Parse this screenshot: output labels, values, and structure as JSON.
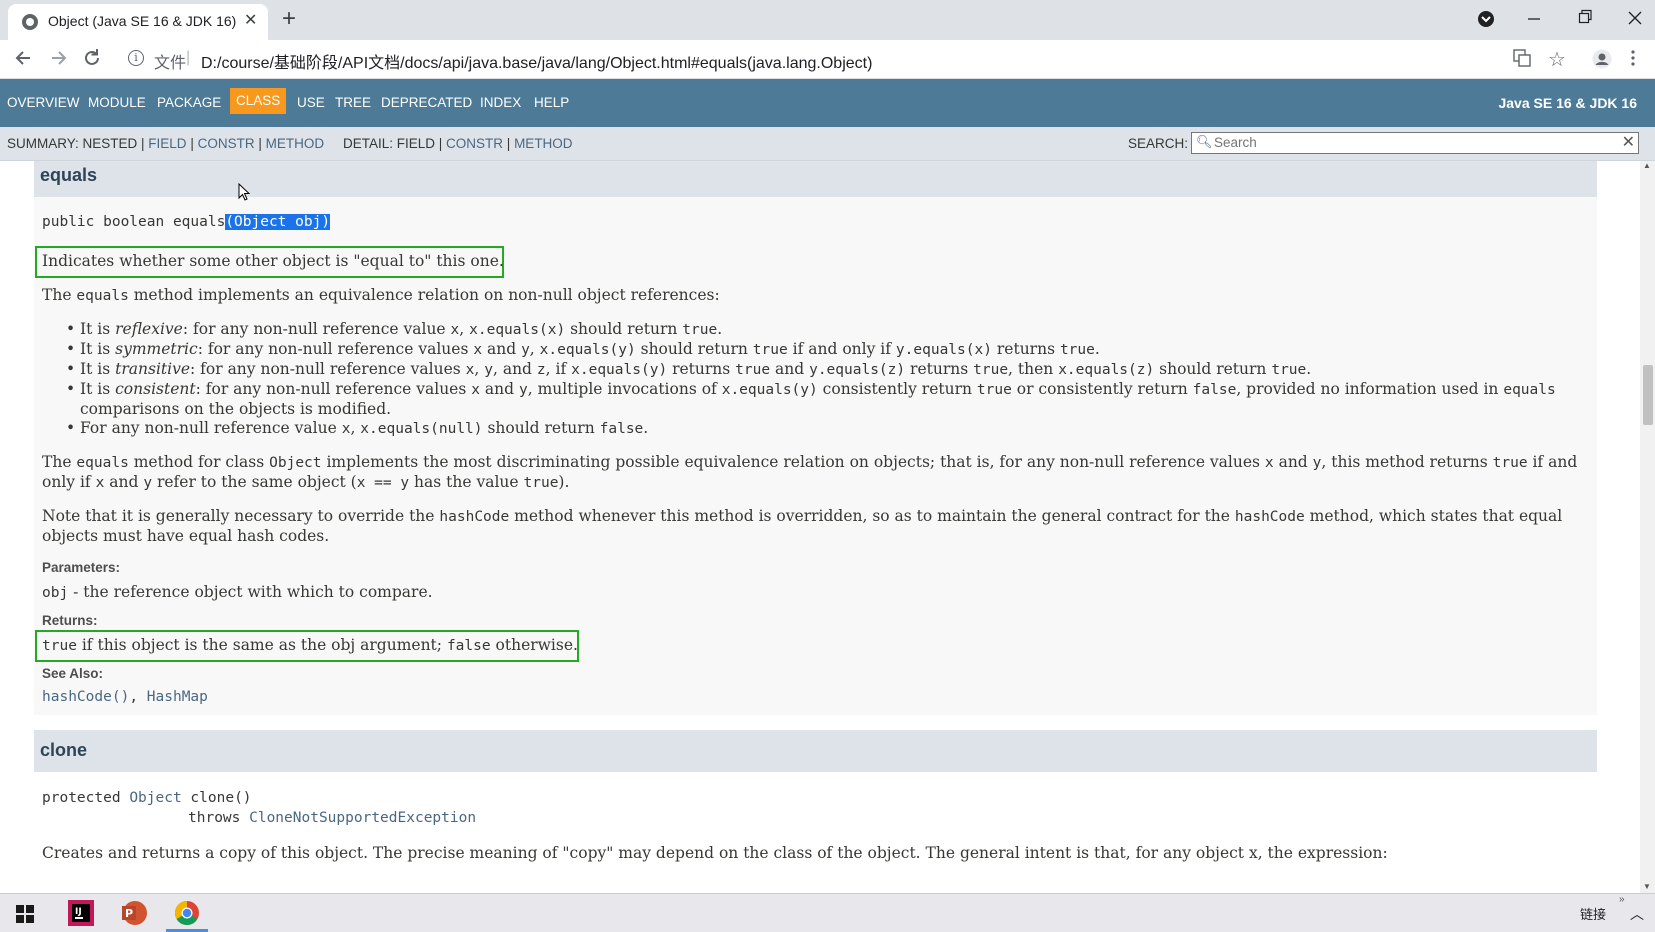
{
  "browser": {
    "tab_title": "Object (Java SE 16 & JDK 16)",
    "tab_close": "✕",
    "new_tab": "+",
    "scheme_label": "文件",
    "url": "D:/course/基础阶段/API文档/docs/api/java.base/java/lang/Object.html#equals(java.lang.Object)",
    "icons": [
      "back-icon",
      "forward-icon",
      "reload-icon",
      "info-icon",
      "translate-icon",
      "star-icon",
      "profile-icon",
      "menu-icon",
      "minimize-icon",
      "restore-icon",
      "close-icon"
    ]
  },
  "topnav": {
    "items": [
      "OVERVIEW",
      "MODULE",
      "PACKAGE",
      "CLASS",
      "USE",
      "TREE",
      "DEPRECATED",
      "INDEX",
      "HELP"
    ],
    "brand": "Java SE 16 & JDK 16",
    "active_color": "#f8981d",
    "bar_color": "#4d7a97"
  },
  "subnav": {
    "summary_label": "SUMMARY: NESTED",
    "summary_links": [
      "FIELD",
      "CONSTR",
      "METHOD"
    ],
    "detail_label": "DETAIL: FIELD",
    "detail_links": [
      "CONSTR",
      "METHOD"
    ],
    "search_label": "SEARCH:",
    "search_placeholder": "Search"
  },
  "equals": {
    "heading": "equals",
    "signature_prefix": "public boolean equals",
    "signature_params": "(Object obj)",
    "summary": "Indicates whether some other object is \"equal to\" this one.",
    "intro": [
      "The ",
      "equals",
      " method implements an equivalence relation on non-null object references:"
    ],
    "bullets": [
      [
        "It is ",
        "reflexive",
        ": for any non-null reference value ",
        "x",
        ", ",
        "x.equals(x)",
        " should return ",
        "true",
        "."
      ],
      [
        "It is ",
        "symmetric",
        ": for any non-null reference values ",
        "x",
        " and ",
        "y",
        ", ",
        "x.equals(y)",
        " should return ",
        "true",
        " if and only if ",
        "y.equals(x)",
        " returns ",
        "true",
        "."
      ],
      [
        "It is ",
        "transitive",
        ": for any non-null reference values ",
        "x",
        ", ",
        "y",
        ", and ",
        "z",
        ", if ",
        "x.equals(y)",
        " returns ",
        "true",
        " and ",
        "y.equals(z)",
        " returns ",
        "true",
        ", then ",
        "x.equals(z)",
        " should return ",
        "true",
        "."
      ],
      [
        "It is ",
        "consistent",
        ": for any non-null reference values ",
        "x",
        " and ",
        "y",
        ", multiple invocations of ",
        "x.equals(y)",
        " consistently return ",
        "true",
        " or consistently return ",
        "false",
        ", provided no information used in ",
        "equals"
      ],
      [
        "comparisons on the objects is modified."
      ],
      [
        "For any non-null reference value ",
        "x",
        ", ",
        "x.equals(null)",
        " should return ",
        "false",
        "."
      ]
    ],
    "para2_line1": [
      "The ",
      "equals",
      " method for class ",
      "Object",
      " implements the most discriminating possible equivalence relation on objects; that is, for any non-null reference values ",
      "x",
      " and ",
      "y",
      ", this method returns ",
      "true",
      " if and"
    ],
    "para2_line2": [
      "only if ",
      "x",
      " and ",
      "y",
      " refer to the same object (",
      "x == y",
      " has the value ",
      "true",
      ")."
    ],
    "para3_line1": [
      "Note that it is generally necessary to override the ",
      "hashCode",
      " method whenever this method is overridden, so as to maintain the general contract for the ",
      "hashCode",
      " method, which states that equal"
    ],
    "para3_line2": "objects must have equal hash codes.",
    "params_label": "Parameters:",
    "param_name": "obj",
    "param_desc": " - the reference object with which to compare.",
    "returns_label": "Returns:",
    "returns": [
      "true",
      " if this object is the same as the obj argument; ",
      "false",
      " otherwise."
    ],
    "see_also_label": "See Also:",
    "see_also": [
      "hashCode()",
      ", ",
      "HashMap"
    ]
  },
  "clone": {
    "heading": "clone",
    "sig_line1": [
      "protected ",
      "Object",
      " clone()"
    ],
    "sig_line2": [
      "throws ",
      "CloneNotSupportedException"
    ],
    "partial_line": "Creates and returns a copy of this object. The precise meaning of \"copy\" may depend on the class of the object. The general intent is that, for any object x, the expression:"
  },
  "taskbar": {
    "tray_label": "链接",
    "apps": [
      "windows-start-icon",
      "intellij-icon",
      "powerpoint-icon",
      "chrome-icon"
    ]
  }
}
